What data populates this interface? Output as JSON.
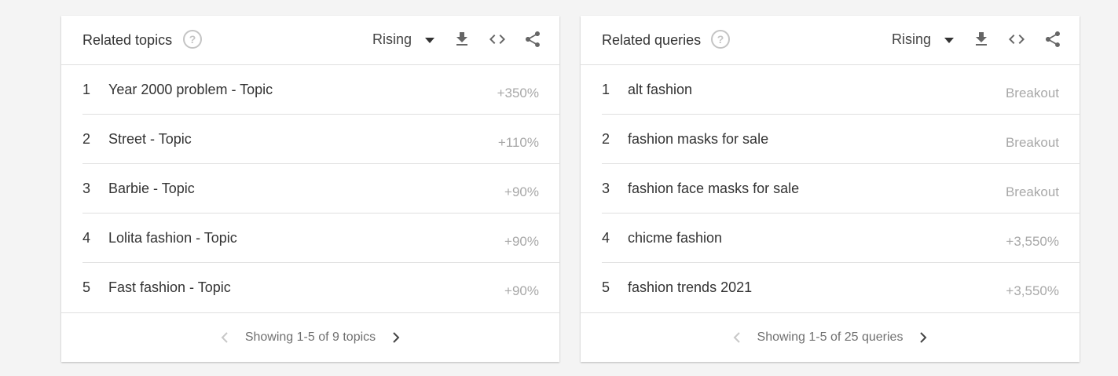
{
  "colors": {
    "text_primary": "#333333",
    "text_muted": "#a8a8a8",
    "icon_gray": "#666666",
    "help_icon": "#c4c4c4",
    "divider": "#e0e0e0"
  },
  "cards": [
    {
      "title": "Related topics",
      "help_icon": "help-circle-icon",
      "filter_label": "Rising",
      "tools": [
        "download-icon",
        "embed-code-icon",
        "share-icon"
      ],
      "rows": [
        {
          "rank": "1",
          "label": "Year 2000 problem - Topic",
          "value": "+350%"
        },
        {
          "rank": "2",
          "label": "Street - Topic",
          "value": "+110%"
        },
        {
          "rank": "3",
          "label": "Barbie - Topic",
          "value": "+90%"
        },
        {
          "rank": "4",
          "label": "Lolita fashion - Topic",
          "value": "+90%"
        },
        {
          "rank": "5",
          "label": "Fast fashion - Topic",
          "value": "+90%"
        }
      ],
      "pager_text": "Showing 1-5 of 9 topics"
    },
    {
      "title": "Related queries",
      "help_icon": "help-circle-icon",
      "filter_label": "Rising",
      "tools": [
        "download-icon",
        "embed-code-icon",
        "share-icon"
      ],
      "rows": [
        {
          "rank": "1",
          "label": "alt fashion",
          "value": "Breakout"
        },
        {
          "rank": "2",
          "label": "fashion masks for sale",
          "value": "Breakout"
        },
        {
          "rank": "3",
          "label": "fashion face masks for sale",
          "value": "Breakout"
        },
        {
          "rank": "4",
          "label": "chicme fashion",
          "value": "+3,550%"
        },
        {
          "rank": "5",
          "label": "fashion trends 2021",
          "value": "+3,550%"
        }
      ],
      "pager_text": "Showing 1-5 of 25 queries"
    }
  ]
}
